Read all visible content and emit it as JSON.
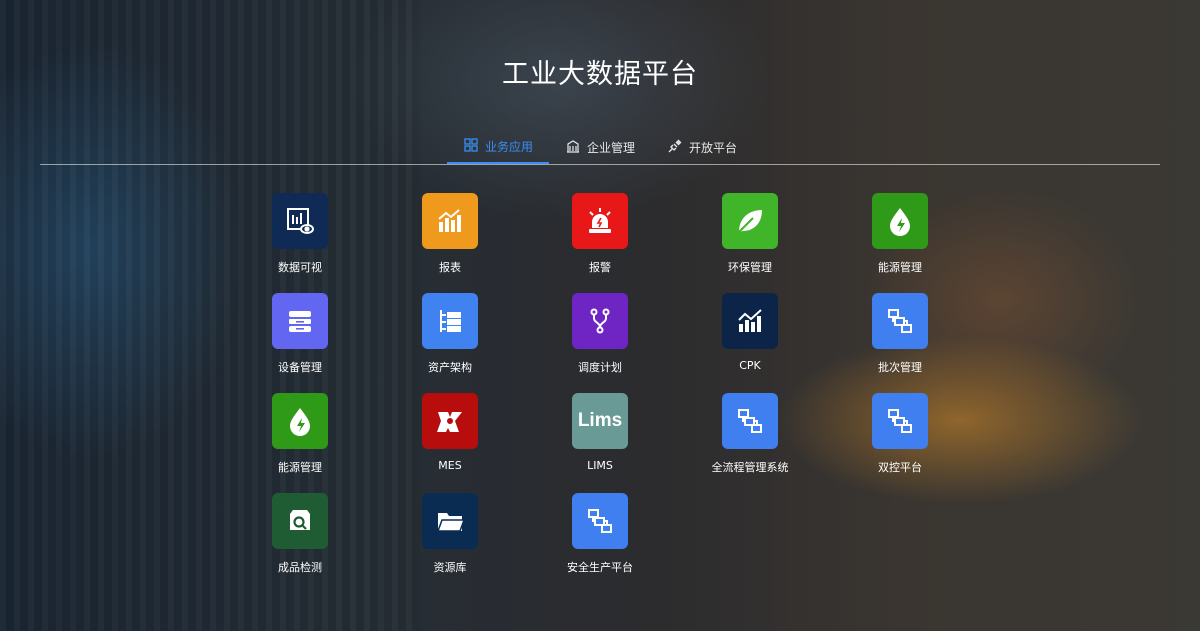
{
  "header": {
    "title": "工业大数据平台"
  },
  "tabs": [
    {
      "label": "业务应用",
      "icon": "grid-icon",
      "active": true
    },
    {
      "label": "企业管理",
      "icon": "building-icon",
      "active": false
    },
    {
      "label": "开放平台",
      "icon": "plug-icon",
      "active": false
    }
  ],
  "apps": [
    {
      "label": "数据可视",
      "icon": "data-visualization-icon",
      "color": "#0e2a55"
    },
    {
      "label": "报表",
      "icon": "report-chart-icon",
      "color": "#ef9a1c"
    },
    {
      "label": "报警",
      "icon": "alarm-siren-icon",
      "color": "#e81818"
    },
    {
      "label": "环保管理",
      "icon": "leaf-icon",
      "color": "#41b52a"
    },
    {
      "label": "能源管理",
      "icon": "energy-drop-icon",
      "color": "#2f9a18"
    },
    {
      "label": "设备管理",
      "icon": "device-box-icon",
      "color": "#6366f1"
    },
    {
      "label": "资产架构",
      "icon": "tree-list-icon",
      "color": "#3f82f0"
    },
    {
      "label": "调度计划",
      "icon": "branch-icon",
      "color": "#6f25c4"
    },
    {
      "label": "CPK",
      "icon": "trend-chart-icon",
      "color": "#0b2447"
    },
    {
      "label": "批次管理",
      "icon": "flow-nodes-icon",
      "color": "#3f7ff0"
    },
    {
      "label": "能源管理",
      "icon": "energy-drop-icon",
      "color": "#2f9a18"
    },
    {
      "label": "MES",
      "icon": "tri-node-icon",
      "color": "#b80d0d"
    },
    {
      "label": "LIMS",
      "icon": "lims-text-icon",
      "color": "#6a9a95",
      "icon_text": "Lims"
    },
    {
      "label": "全流程管理系统",
      "icon": "flow-nodes-icon",
      "color": "#3f7ff0"
    },
    {
      "label": "双控平台",
      "icon": "flow-nodes-icon",
      "color": "#3f7ff0"
    },
    {
      "label": "成品检测",
      "icon": "inspect-box-icon",
      "color": "#1f5c33"
    },
    {
      "label": "资源库",
      "icon": "folder-icon",
      "color": "#0b2c52"
    },
    {
      "label": "安全生产平台",
      "icon": "flow-nodes-icon",
      "color": "#3f7ff0"
    }
  ]
}
